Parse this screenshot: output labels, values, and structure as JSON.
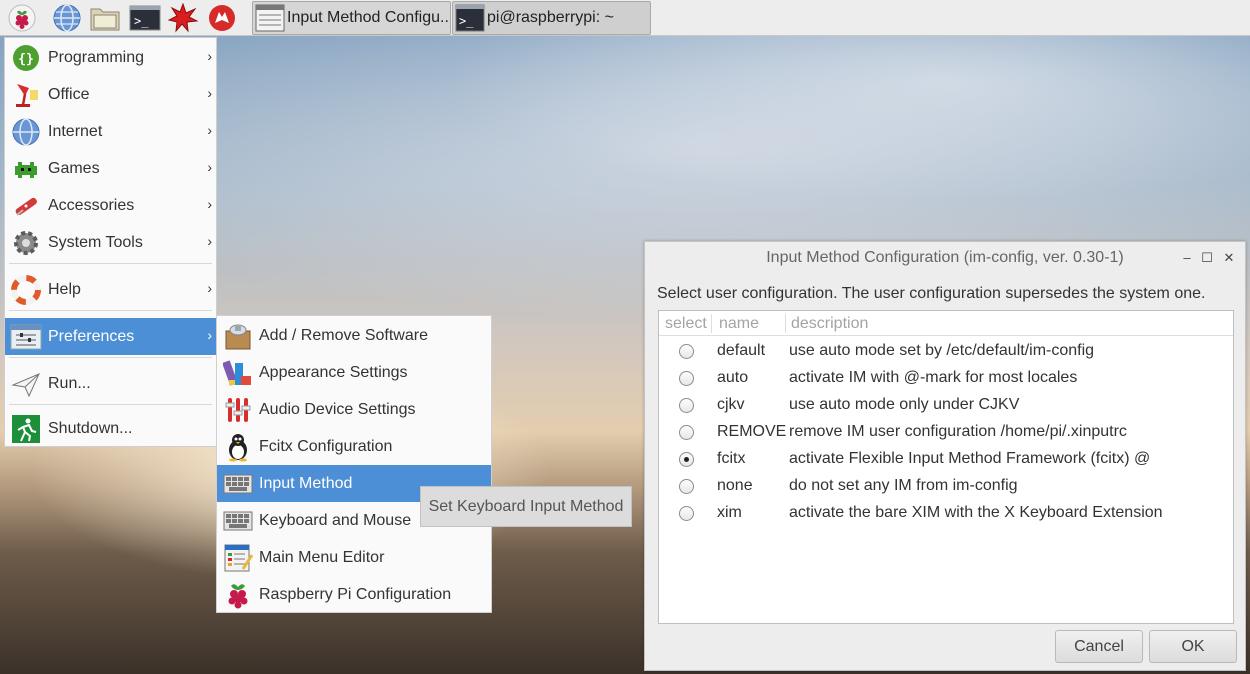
{
  "taskbar": {
    "launchers": [
      {
        "icon": "raspberry-menu-icon"
      },
      {
        "icon": "web-browser-icon"
      },
      {
        "icon": "file-manager-icon"
      },
      {
        "icon": "terminal-icon"
      },
      {
        "icon": "mathematica-icon"
      },
      {
        "icon": "wolfram-icon"
      }
    ],
    "tasks": [
      {
        "label": "Input Method Configu...",
        "icon": "input-method-window-icon",
        "active": true
      },
      {
        "label": "pi@raspberrypi: ~",
        "icon": "terminal-icon",
        "active": false
      }
    ]
  },
  "main_menu": {
    "items": [
      {
        "label": "Programming",
        "icon": "programming-icon",
        "submenu": true
      },
      {
        "label": "Office",
        "icon": "office-icon",
        "submenu": true
      },
      {
        "label": "Internet",
        "icon": "internet-icon",
        "submenu": true
      },
      {
        "label": "Games",
        "icon": "games-icon",
        "submenu": true
      },
      {
        "label": "Accessories",
        "icon": "accessories-icon",
        "submenu": true
      },
      {
        "label": "System Tools",
        "icon": "system-tools-icon",
        "submenu": true
      },
      {
        "label": "Help",
        "icon": "help-icon",
        "submenu": true
      },
      {
        "label": "Preferences",
        "icon": "preferences-icon",
        "submenu": true,
        "selected": true
      },
      {
        "label": "Run...",
        "icon": "run-icon",
        "submenu": false
      },
      {
        "label": "Shutdown...",
        "icon": "shutdown-icon",
        "submenu": false
      }
    ],
    "arrow": "›"
  },
  "preferences_menu": {
    "items": [
      {
        "label": "Add / Remove Software",
        "icon": "add-remove-software-icon"
      },
      {
        "label": "Appearance Settings",
        "icon": "appearance-settings-icon"
      },
      {
        "label": "Audio Device Settings",
        "icon": "audio-device-settings-icon"
      },
      {
        "label": "Fcitx Configuration",
        "icon": "fcitx-icon"
      },
      {
        "label": "Input Method",
        "icon": "input-method-icon",
        "selected": true
      },
      {
        "label": "Keyboard and Mouse",
        "icon": "keyboard-icon"
      },
      {
        "label": "Main Menu Editor",
        "icon": "menu-editor-icon"
      },
      {
        "label": "Raspberry Pi Configuration",
        "icon": "raspberry-pi-config-icon"
      }
    ]
  },
  "tooltip": {
    "text": "Set Keyboard Input Method"
  },
  "dialog": {
    "title": "Input Method Configuration (im-config, ver. 0.30-1)",
    "controls": {
      "minimize": "–",
      "maximize": "☐",
      "close": "✕"
    },
    "prompt": "Select user configuration. The user configuration supersedes the system one.",
    "columns": {
      "select": "select",
      "name": "name",
      "description": "description"
    },
    "rows": [
      {
        "name": "default",
        "description": "use auto mode set by /etc/default/im-config",
        "selected": false
      },
      {
        "name": "auto",
        "description": "activate IM with @-mark for most locales",
        "selected": false
      },
      {
        "name": "cjkv",
        "description": "use auto mode only under CJKV",
        "selected": false
      },
      {
        "name": "REMOVE",
        "description": "remove IM user configuration /home/pi/.xinputrc",
        "selected": false
      },
      {
        "name": "fcitx",
        "description": "activate Flexible Input Method Framework (fcitx) @",
        "selected": true
      },
      {
        "name": "none",
        "description": "do not set any IM from im-config",
        "selected": false
      },
      {
        "name": "xim",
        "description": "activate the bare XIM with the X Keyboard Extension",
        "selected": false
      }
    ],
    "buttons": {
      "cancel": "Cancel",
      "ok": "OK"
    }
  },
  "colors": {
    "menu_highlight": "#4d8fd6",
    "panel": "#ededed"
  }
}
